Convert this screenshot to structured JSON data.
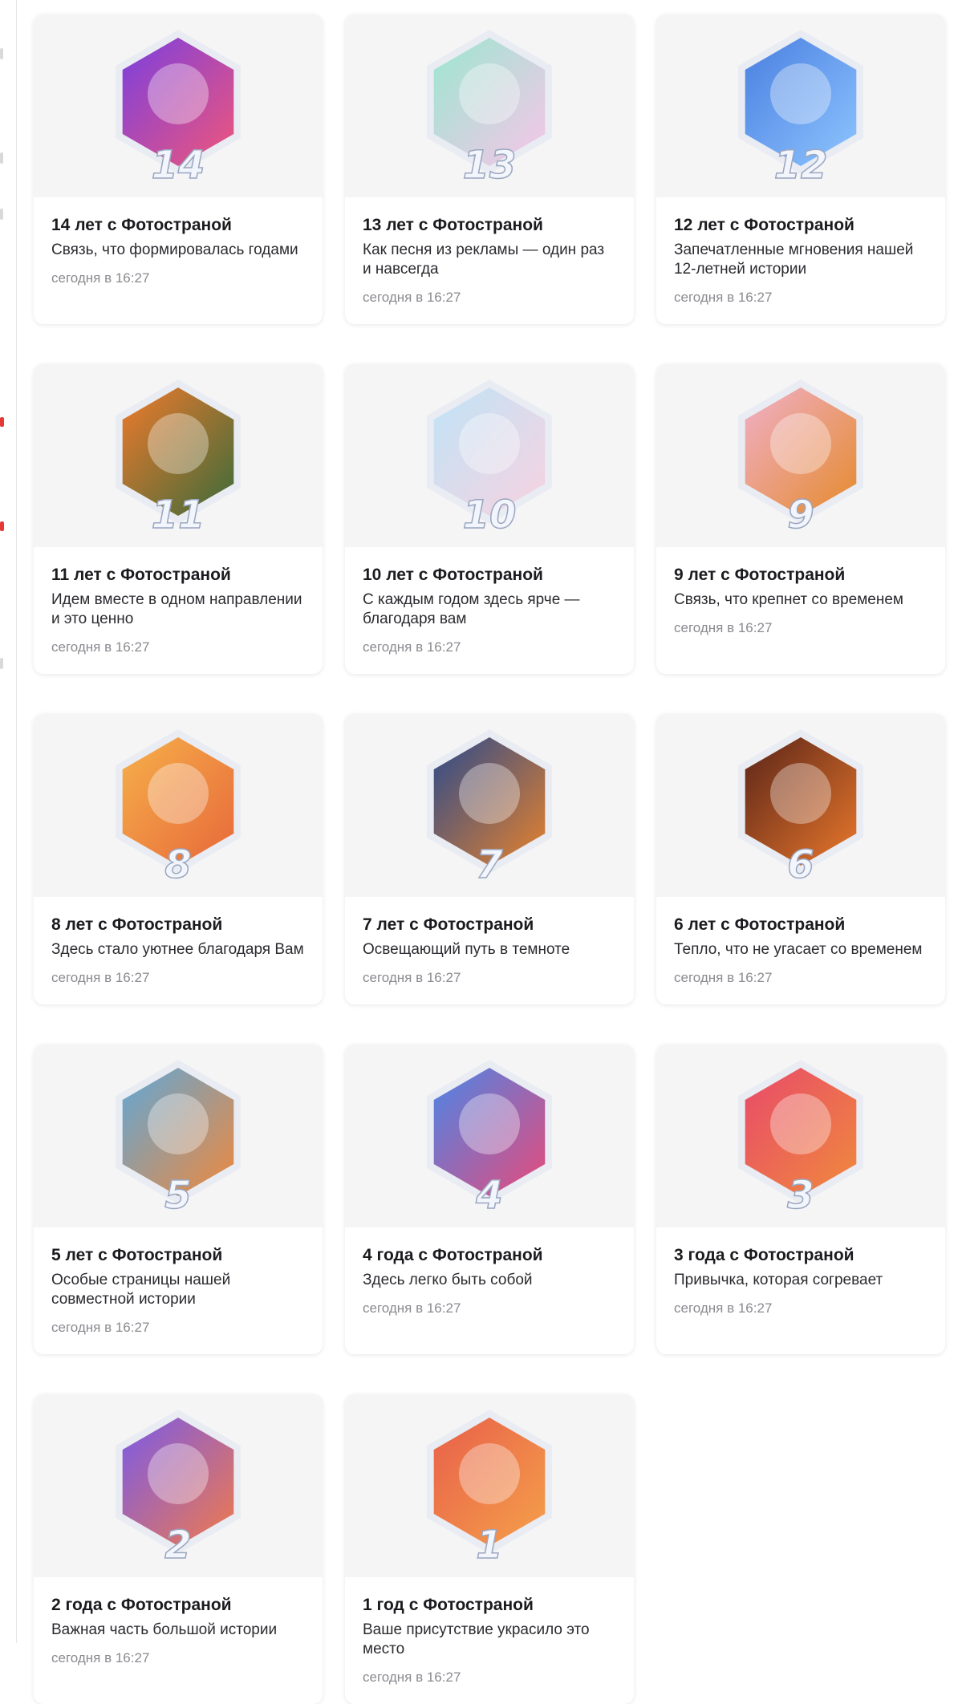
{
  "cards": [
    {
      "title": "14 лет с Фотостраной",
      "desc": "Связь, что формировалась годами",
      "time": "сегодня в 16:27",
      "badge_number": "14",
      "icon": "chain-icon",
      "colors": [
        "#7a3fe0",
        "#f0567a"
      ]
    },
    {
      "title": "13 лет с Фотостраной",
      "desc": "Как песня из рекламы — один раз и навсегда",
      "time": "сегодня в 16:27",
      "badge_number": "13",
      "icon": "music-notes-icon",
      "colors": [
        "#9be7d0",
        "#f7c5e8"
      ]
    },
    {
      "title": "12 лет с Фотостраной",
      "desc": "Запечатленные мгновения нашей 12-летней истории",
      "time": "сегодня в 16:27",
      "badge_number": "12",
      "icon": "camera-icon",
      "colors": [
        "#4a7fe0",
        "#8ec5ff"
      ]
    },
    {
      "title": "11 лет с Фотостраной",
      "desc": "Идем вместе в одном направлении и это ценно",
      "time": "сегодня в 16:27",
      "badge_number": "11",
      "icon": "compass-icon",
      "colors": [
        "#f07a2c",
        "#3b6b3a"
      ]
    },
    {
      "title": "10 лет с Фотостраной",
      "desc": "С каждым годом здесь ярче — благодаря вам",
      "time": "сегодня в 16:27",
      "badge_number": "10",
      "icon": "confetti-icon",
      "colors": [
        "#bfe4f7",
        "#f8d2e0"
      ]
    },
    {
      "title": "9 лет с Фотостраной",
      "desc": "Связь, что крепнет со временем",
      "time": "сегодня в 16:27",
      "badge_number": "9",
      "icon": "heart-knot-icon",
      "colors": [
        "#f0b0c8",
        "#e58a2c"
      ]
    },
    {
      "title": "8 лет с Фотостраной",
      "desc": "Здесь стало уютнее благодаря Вам",
      "time": "сегодня в 16:27",
      "badge_number": "8",
      "icon": "armchair-icon",
      "colors": [
        "#f6b04a",
        "#e7683a"
      ]
    },
    {
      "title": "7 лет с Фотостраной",
      "desc": "Освещающий путь в темноте",
      "time": "сегодня в 16:27",
      "badge_number": "7",
      "icon": "lantern-icon",
      "colors": [
        "#2b4a8c",
        "#e7822c"
      ]
    },
    {
      "title": "6 лет с Фотостраной",
      "desc": "Тепло, что не угасает со временем",
      "time": "сегодня в 16:27",
      "badge_number": "6",
      "icon": "fireplace-icon",
      "colors": [
        "#5a2418",
        "#e9782c"
      ]
    },
    {
      "title": "5 лет с Фотостраной",
      "desc": "Особые страницы нашей совместной истории",
      "time": "сегодня в 16:27",
      "badge_number": "5",
      "icon": "photo-album-icon",
      "colors": [
        "#5fa8d8",
        "#f0883c"
      ]
    },
    {
      "title": "4 года с Фотостраной",
      "desc": "Здесь легко быть собой",
      "time": "сегодня в 16:27",
      "badge_number": "4",
      "icon": "heart-balloon-icon",
      "colors": [
        "#4a86e8",
        "#e84a7a"
      ]
    },
    {
      "title": "3 года с Фотостраной",
      "desc": "Привычка, которая согревает",
      "time": "сегодня в 16:27",
      "badge_number": "3",
      "icon": "coffee-cup-icon",
      "colors": [
        "#e84a6a",
        "#f08a3c"
      ]
    },
    {
      "title": "2 года с Фотостраной",
      "desc": "Важная часть большой истории",
      "time": "сегодня в 16:27",
      "badge_number": "2",
      "icon": "puzzle-icon",
      "colors": [
        "#7a5ae8",
        "#f07a4c"
      ]
    },
    {
      "title": "1 год с Фотостраной",
      "desc": "Ваше присутствие украсило это место",
      "time": "сегодня в 16:27",
      "badge_number": "1",
      "icon": "daisy-flower-icon",
      "colors": [
        "#e8604a",
        "#f5a04a"
      ]
    }
  ]
}
